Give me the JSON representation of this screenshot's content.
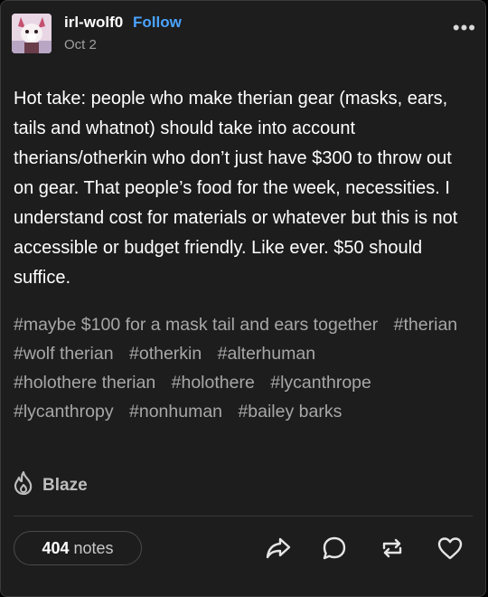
{
  "post": {
    "author": "irl-wolf0",
    "follow_label": "Follow",
    "date": "Oct 2",
    "body": "Hot take: people who make therian gear (masks, ears, tails and whatnot) should take into account therians/otherkin who don’t just have $300 to throw out on gear. That people’s food for the week, necessities. I understand cost for materials or whatever but this is not accessible or budget friendly. Like ever. $50 should suffice.",
    "tags": [
      "#maybe $100 for a mask tail and ears together",
      "#therian",
      "#wolf therian",
      "#otherkin",
      "#alterhuman",
      "#holothere therian",
      "#holothere",
      "#lycanthrope",
      "#lycanthropy",
      "#nonhuman",
      "#bailey barks"
    ],
    "blaze_label": "Blaze"
  },
  "footer": {
    "notes_count": "404",
    "notes_label": "notes"
  },
  "icons": {
    "more": "more-options-icon",
    "blaze": "flame-icon",
    "share": "share-icon",
    "reply": "reply-icon",
    "reblog": "reblog-icon",
    "like": "heart-icon"
  },
  "colors": {
    "background": "#1d1d1d",
    "text": "#ffffff",
    "link": "#4aa3ff",
    "muted": "#a7a7a7"
  }
}
